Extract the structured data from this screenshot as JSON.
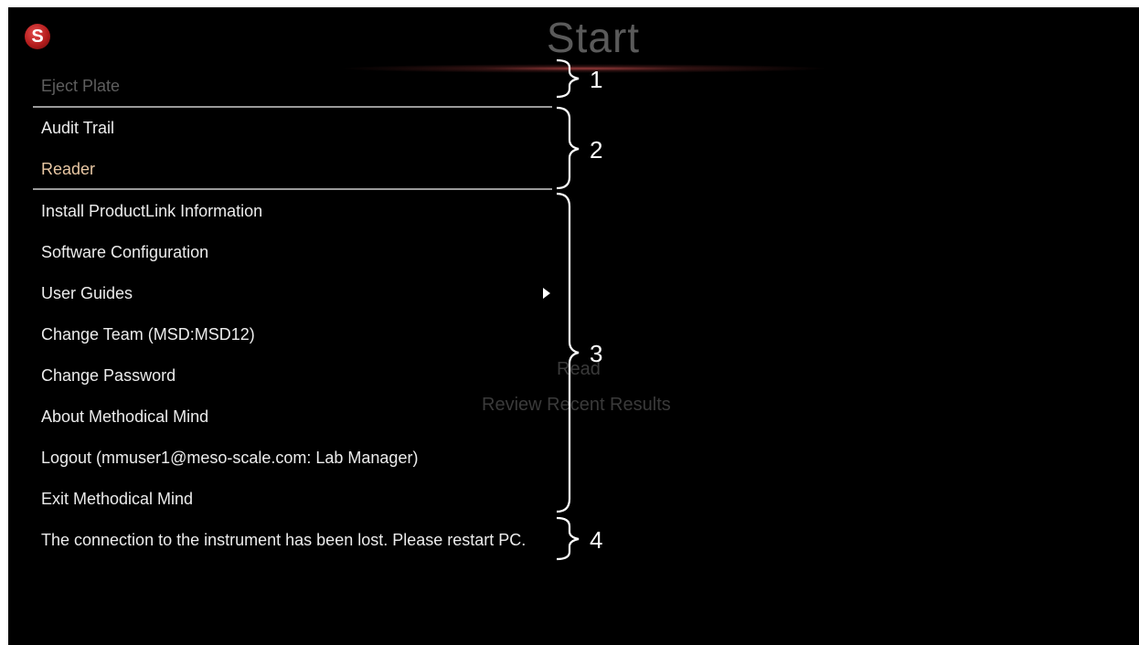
{
  "header": {
    "title": "Start",
    "logo_letter": "S"
  },
  "background": {
    "read": "Read",
    "review": "Review Recent Results"
  },
  "menu": {
    "eject": "Eject Plate",
    "audit": "Audit Trail",
    "reader": "Reader",
    "install": "Install ProductLink Information",
    "software": "Software Configuration",
    "guides": "User Guides",
    "team": "Change Team (MSD:MSD12)",
    "password": "Change Password",
    "about": "About Methodical Mind",
    "logout": "Logout (mmuser1@meso-scale.com: Lab Manager)",
    "exit": "Exit Methodical Mind"
  },
  "status_message": "The connection to the instrument has been lost. Please restart PC.",
  "callouts": [
    "1",
    "2",
    "3",
    "4"
  ],
  "colors": {
    "background": "#000000",
    "text": "#ececec",
    "disabled": "#5e5e5e",
    "selected": "#e8c7a3",
    "accent": "#b51d1d"
  }
}
